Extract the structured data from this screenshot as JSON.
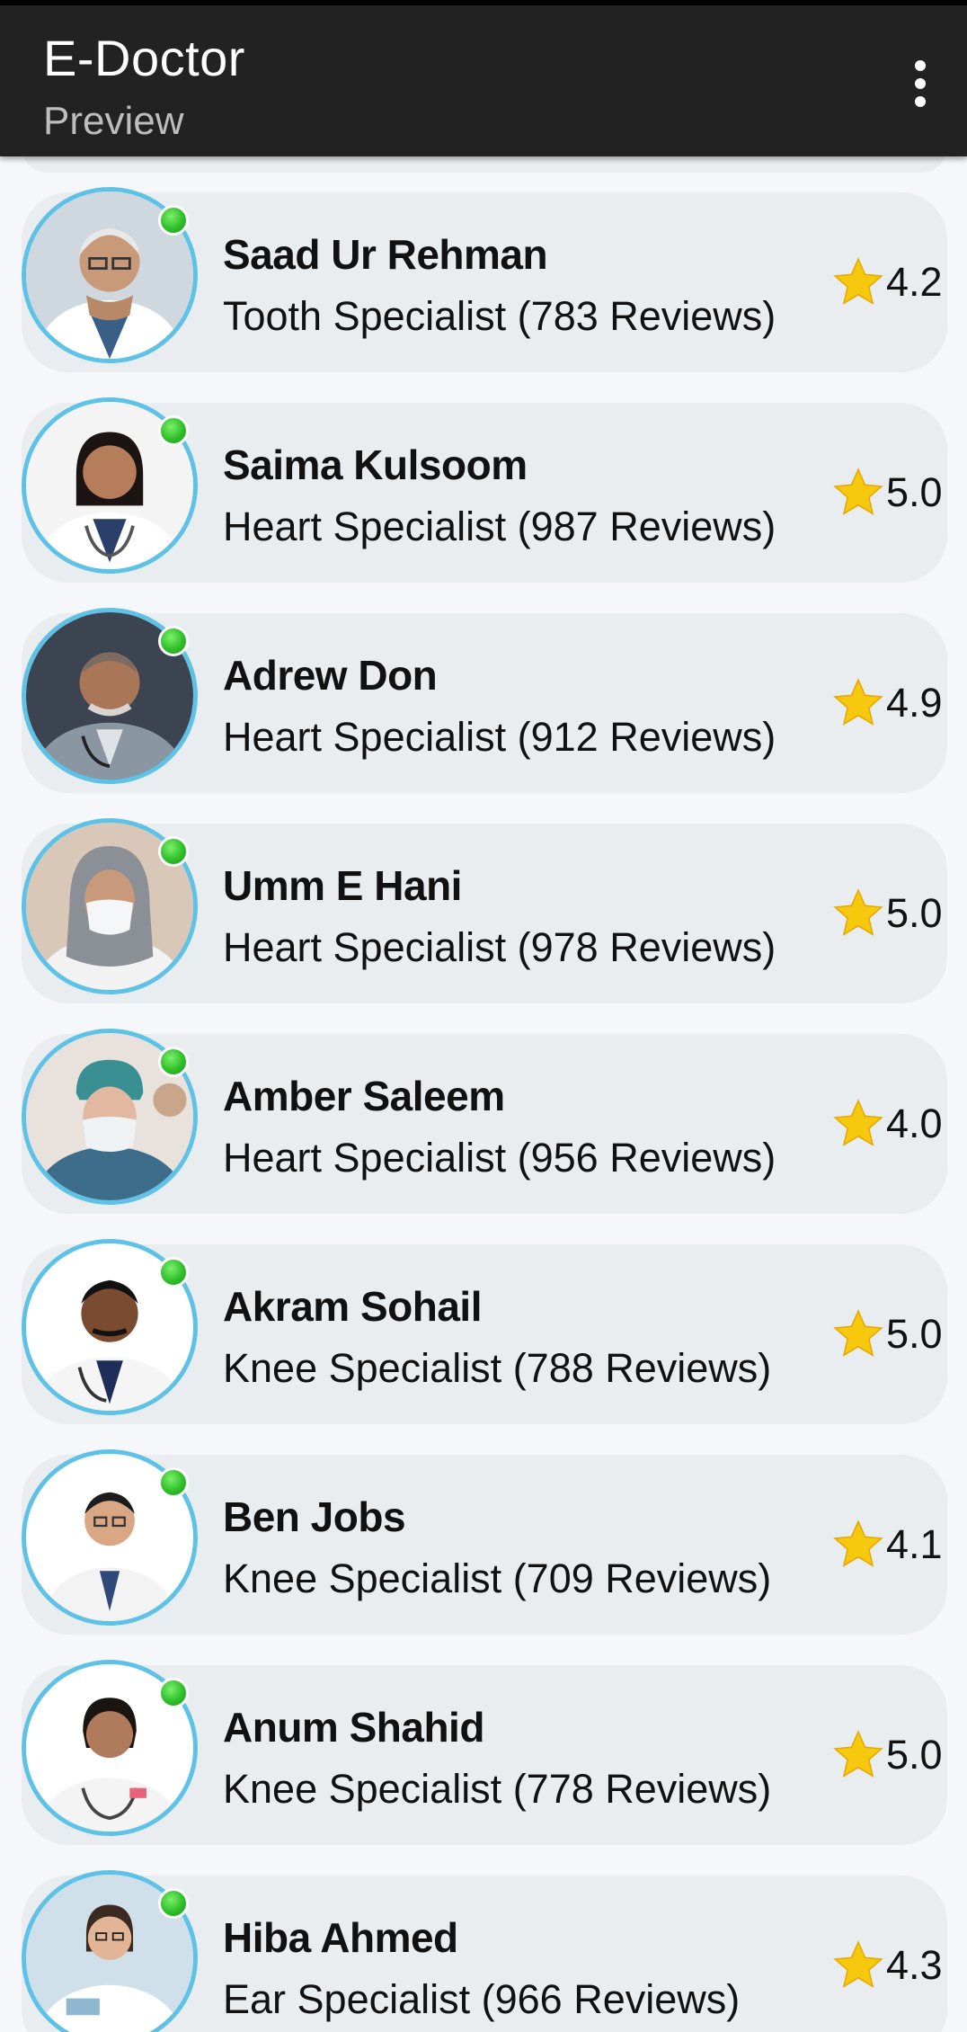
{
  "app": {
    "title": "E-Doctor",
    "subtitle": "Preview",
    "menu_icon": "more-vert-icon"
  },
  "doctors": [
    {
      "name": "Saad Ur Rehman",
      "specialty": "Tooth Specialist (783 Reviews)",
      "rating": "4.2",
      "online": true
    },
    {
      "name": "Saima Kulsoom",
      "specialty": "Heart Specialist (987 Reviews)",
      "rating": "5.0",
      "online": true
    },
    {
      "name": "Adrew Don",
      "specialty": "Heart Specialist (912 Reviews)",
      "rating": "4.9",
      "online": true
    },
    {
      "name": "Umm E Hani",
      "specialty": "Heart Specialist (978 Reviews)",
      "rating": "5.0",
      "online": true
    },
    {
      "name": "Amber Saleem",
      "specialty": "Heart Specialist (956 Reviews)",
      "rating": "4.0",
      "online": true
    },
    {
      "name": "Akram Sohail",
      "specialty": "Knee Specialist (788 Reviews)",
      "rating": "5.0",
      "online": true
    },
    {
      "name": "Ben Jobs",
      "specialty": "Knee Specialist (709 Reviews)",
      "rating": "4.1",
      "online": true
    },
    {
      "name": "Anum Shahid",
      "specialty": "Knee Specialist (778 Reviews)",
      "rating": "5.0",
      "online": true
    },
    {
      "name": "Hiba Ahmed",
      "specialty": "Ear Specialist (966 Reviews)",
      "rating": "4.3",
      "online": true
    }
  ],
  "colors": {
    "appbar": "#222222",
    "card": "#e9edf0",
    "avatar_ring": "#5ec1e6",
    "online": "#2fbf2a",
    "star": "#f6c90e"
  }
}
